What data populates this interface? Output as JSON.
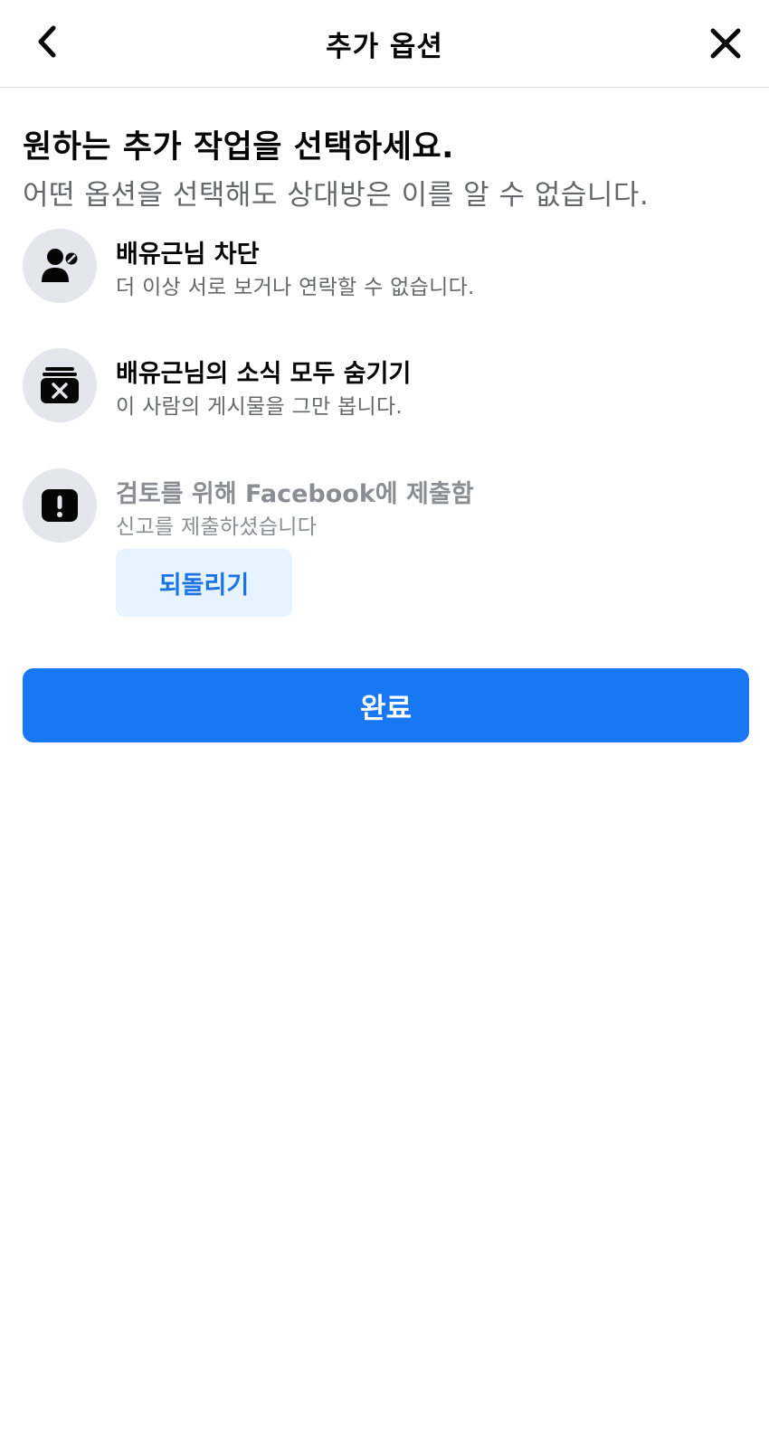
{
  "header": {
    "title": "추가 옵션",
    "back_icon": "chevron-left-icon",
    "close_icon": "close-icon"
  },
  "intro": {
    "heading": "원하는 추가 작업을 선택하세요.",
    "subheading": "어떤 옵션을 선택해도 상대방은 이를 알 수 없습니다."
  },
  "options": [
    {
      "icon": "user-block-icon",
      "title": "배유근님 차단",
      "description": "더 이상 서로 보거나 연락할 수 없습니다."
    },
    {
      "icon": "hide-posts-icon",
      "title": "배유근님의 소식 모두 숨기기",
      "description": "이 사람의 게시물을 그만 봅니다."
    },
    {
      "icon": "report-icon",
      "title": "검토를 위해 Facebook에 제출함",
      "description": "신고를 제출하셨습니다",
      "action_label": "되돌리기"
    }
  ],
  "done_label": "완료",
  "colors": {
    "primary": "#1877f2",
    "undo_bg": "#e7f3ff",
    "undo_text": "#1b74e4",
    "icon_bg": "#e4e6eb",
    "secondary_text": "#65676b"
  }
}
